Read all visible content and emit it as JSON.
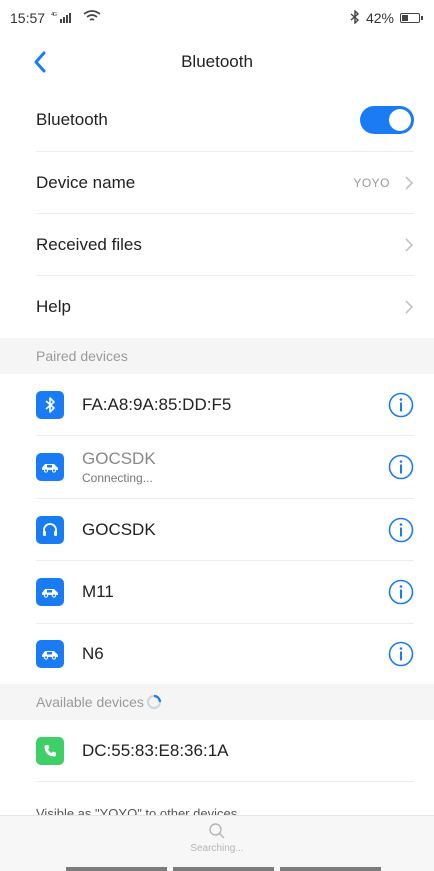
{
  "status": {
    "time": "15:57",
    "network": "4G",
    "battery_text": "42%",
    "battery_level": 0.42
  },
  "header": {
    "title": "Bluetooth"
  },
  "settings": {
    "bluetooth_label": "Bluetooth",
    "bluetooth_on": true,
    "device_name_label": "Device name",
    "device_name_value": "YOYO",
    "received_files_label": "Received files",
    "help_label": "Help"
  },
  "paired": {
    "header": "Paired devices",
    "devices": [
      {
        "name": "FA:A8:9A:85:DD:F5",
        "status": "",
        "icon": "bluetooth-icon"
      },
      {
        "name": "GOCSDK",
        "status": "Connecting...",
        "icon": "car-icon"
      },
      {
        "name": "GOCSDK",
        "status": "",
        "icon": "headset-icon"
      },
      {
        "name": "M11",
        "status": "",
        "icon": "car-icon"
      },
      {
        "name": "N6",
        "status": "",
        "icon": "car-icon"
      }
    ]
  },
  "available": {
    "header": "Available devices",
    "devices": [
      {
        "name": "DC:55:83:E8:36:1A",
        "icon": "phone-icon"
      }
    ]
  },
  "footer": {
    "visible_text": "Visible as \"YOYO\" to other devices",
    "searching": "Searching..."
  },
  "colors": {
    "accent": "#1a7cf5",
    "phone": "#3ecf67"
  }
}
